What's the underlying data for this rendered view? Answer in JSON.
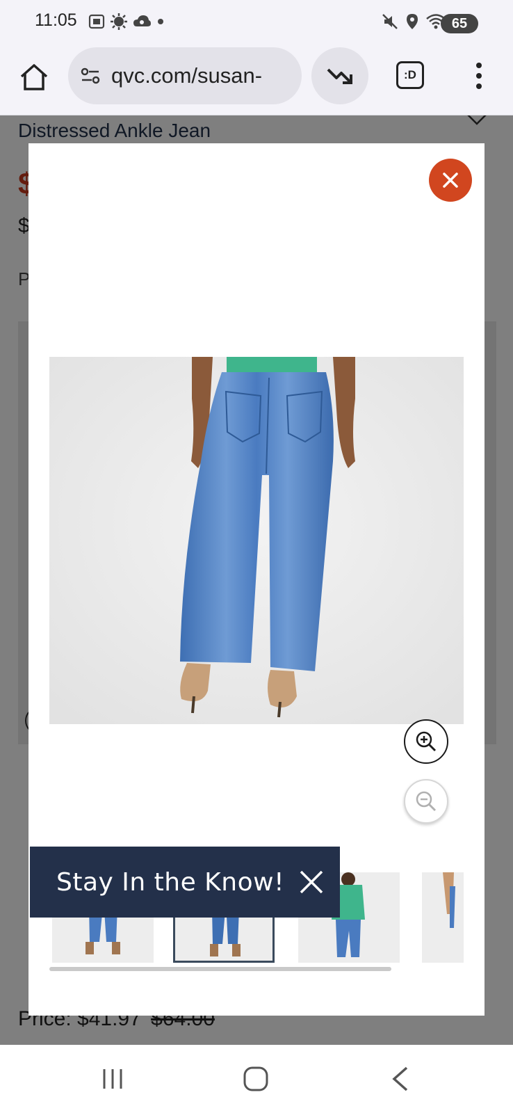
{
  "status_bar": {
    "time": "11:05",
    "battery": "65"
  },
  "browser": {
    "url": "qvc.com/susan-",
    "tabs_icon_label": ":D"
  },
  "page": {
    "title": "Distressed Ankle Jean",
    "price_red_partial": "$",
    "price_small_partial": "$",
    "label_partial": "P",
    "bottom_price_label": "Price:",
    "bottom_price": "$41.97",
    "bottom_old_price": "$64.00"
  },
  "modal": {
    "toast_text": "Stay In the Know!",
    "thumbnails": [
      {
        "name": "thumb-1",
        "active": false
      },
      {
        "name": "thumb-2",
        "active": true
      },
      {
        "name": "thumb-3",
        "active": false
      },
      {
        "name": "thumb-4",
        "active": false
      }
    ]
  },
  "colors": {
    "close_button": "#d1461f",
    "toast_bg": "#23304a",
    "jean_blue": "#4a78bb",
    "top_green": "#3fb58c"
  }
}
